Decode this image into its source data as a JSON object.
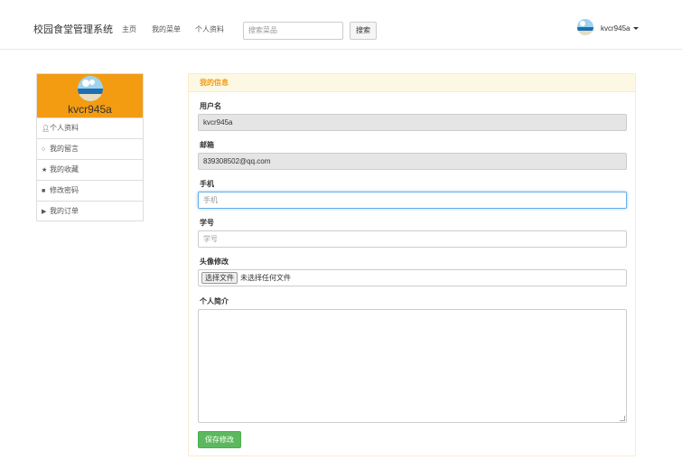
{
  "navbar": {
    "brand": "校园食堂管理系统",
    "links": [
      "主页",
      "我的菜单",
      "个人资料"
    ],
    "search_placeholder": "搜索菜品",
    "search_button": "搜索",
    "user": "kvcr945a"
  },
  "sidebar": {
    "username": "kvcr945a",
    "items": [
      {
        "label": "个人资料",
        "icon": "user-icon"
      },
      {
        "label": "我的留言",
        "icon": "comment-icon"
      },
      {
        "label": "我的收藏",
        "icon": "star-icon"
      },
      {
        "label": "修改密码",
        "icon": "lock-icon"
      },
      {
        "label": "我的订单",
        "icon": "tag-icon"
      }
    ]
  },
  "panel": {
    "title": "我的信息",
    "username_label": "用户名",
    "username_value": "kvcr945a",
    "email_label": "邮箱",
    "email_value": "839308502@qq.com",
    "phone_label": "手机",
    "phone_placeholder": "手机",
    "student_id_label": "学号",
    "student_id_placeholder": "学号",
    "avatar_label": "头像修改",
    "file_button": "选择文件",
    "file_status": "未选择任何文件",
    "bio_label": "个人简介",
    "save_button": "保存修改"
  },
  "colors": {
    "accent": "#f39c12",
    "panel_border": "#faebcc",
    "panel_heading_bg": "#fcf8e3",
    "save_green": "#5cb85c",
    "focus_blue": "#66afe9"
  }
}
